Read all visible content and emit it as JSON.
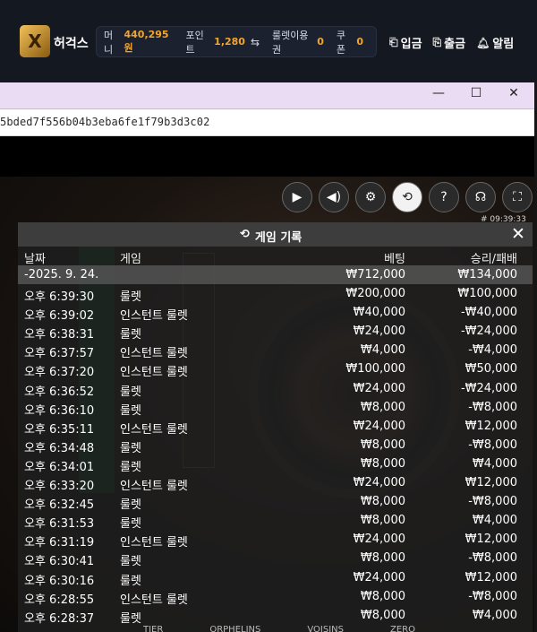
{
  "site": {
    "name": "허걱스",
    "logo_letter": "X",
    "balance": {
      "money_label": "머니",
      "money_value": "440,295원",
      "point_label": "포인트",
      "point_value": "1,280",
      "roulette_label": "룰렛이용권",
      "roulette_value": "0",
      "coupon_label": "쿠폰",
      "coupon_value": "0"
    },
    "actions": {
      "deposit": "입금",
      "withdraw": "출금",
      "alarm": "알림"
    }
  },
  "window": {
    "url": "5bded7f556b04b3eba6fe1f79b3d3c02"
  },
  "game": {
    "game_id": "# 09:39:33",
    "controls": [
      "video-icon",
      "volume-icon",
      "settings-icon",
      "history-icon",
      "help-icon",
      "headset-icon",
      "fullscreen-icon"
    ],
    "bottom_tabs": [
      "TIER",
      "ORPHELINS",
      "VOISINS",
      "ZERO"
    ]
  },
  "history": {
    "title": "게임 기록",
    "columns": {
      "date": "날짜",
      "game": "게임",
      "bet": "베팅",
      "result": "승리/패배"
    },
    "summary": {
      "date": "-2025. 9. 24.",
      "bet": "₩712,000",
      "result": "₩134,000"
    },
    "rows": [
      {
        "time": "오후 6:39:30",
        "game": "룰렛",
        "bet": "₩200,000",
        "result": "₩100,000"
      },
      {
        "time": "오후 6:39:02",
        "game": "인스턴트 룰렛",
        "bet": "₩40,000",
        "result": "-₩40,000"
      },
      {
        "time": "오후 6:38:31",
        "game": "룰렛",
        "bet": "₩24,000",
        "result": "-₩24,000"
      },
      {
        "time": "오후 6:37:57",
        "game": "인스턴트 룰렛",
        "bet": "₩4,000",
        "result": "-₩4,000"
      },
      {
        "time": "오후 6:37:20",
        "game": "인스턴트 룰렛",
        "bet": "₩100,000",
        "result": "₩50,000"
      },
      {
        "time": "오후 6:36:52",
        "game": "룰렛",
        "bet": "₩24,000",
        "result": "-₩24,000"
      },
      {
        "time": "오후 6:36:10",
        "game": "룰렛",
        "bet": "₩8,000",
        "result": "-₩8,000"
      },
      {
        "time": "오후 6:35:11",
        "game": "인스턴트 룰렛",
        "bet": "₩24,000",
        "result": "₩12,000"
      },
      {
        "time": "오후 6:34:48",
        "game": "룰렛",
        "bet": "₩8,000",
        "result": "-₩8,000"
      },
      {
        "time": "오후 6:34:01",
        "game": "룰렛",
        "bet": "₩8,000",
        "result": "₩4,000"
      },
      {
        "time": "오후 6:33:20",
        "game": "인스턴트 룰렛",
        "bet": "₩24,000",
        "result": "₩12,000"
      },
      {
        "time": "오후 6:32:45",
        "game": "룰렛",
        "bet": "₩8,000",
        "result": "-₩8,000"
      },
      {
        "time": "오후 6:31:53",
        "game": "룰렛",
        "bet": "₩8,000",
        "result": "₩4,000"
      },
      {
        "time": "오후 6:31:19",
        "game": "인스턴트 룰렛",
        "bet": "₩24,000",
        "result": "₩12,000"
      },
      {
        "time": "오후 6:30:41",
        "game": "룰렛",
        "bet": "₩8,000",
        "result": "-₩8,000"
      },
      {
        "time": "오후 6:30:16",
        "game": "룰렛",
        "bet": "₩24,000",
        "result": "₩12,000"
      },
      {
        "time": "오후 6:28:55",
        "game": "인스턴트 룰렛",
        "bet": "₩8,000",
        "result": "-₩8,000"
      },
      {
        "time": "오후 6:28:37",
        "game": "룰렛",
        "bet": "₩8,000",
        "result": "₩4,000"
      }
    ]
  }
}
